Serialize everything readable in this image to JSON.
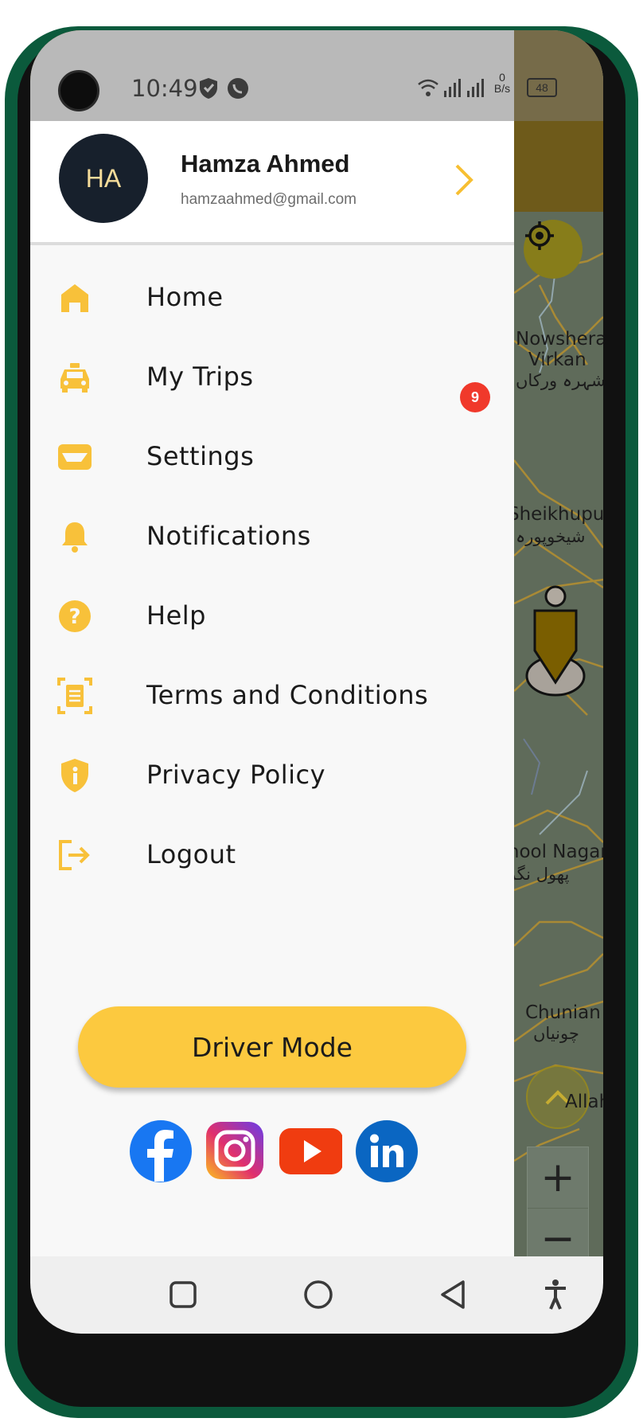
{
  "status_bar": {
    "time": "10:49",
    "speed_value": "0",
    "speed_unit": "B/s",
    "battery": "48"
  },
  "profile": {
    "initials": "HA",
    "name": "Hamza Ahmed",
    "email": "hamzaahmed@gmail.com"
  },
  "menu": {
    "items": [
      {
        "label": "Home",
        "icon": "home-icon"
      },
      {
        "label": "My Trips",
        "icon": "taxi-icon"
      },
      {
        "label": "Settings",
        "icon": "card-icon"
      },
      {
        "label": "Notifications",
        "icon": "bell-icon"
      },
      {
        "label": "Help",
        "icon": "help-icon"
      },
      {
        "label": "Terms and Conditions",
        "icon": "document-scan-icon"
      },
      {
        "label": "Privacy Policy",
        "icon": "shield-info-icon"
      },
      {
        "label": "Logout",
        "icon": "logout-icon"
      }
    ],
    "notifications_badge": "9"
  },
  "driver_mode_label": "Driver Mode",
  "social": [
    "facebook-icon",
    "instagram-icon",
    "youtube-icon",
    "linkedin-icon"
  ],
  "map": {
    "labels": {
      "nowshera_1": "Nowshera",
      "nowshera_2": "Virkan",
      "nowshera_urdu": "نوشہرہ ورکاں",
      "sheikhupura": "Sheikhupura",
      "sheikhupura_urdu": "شیخوپورہ",
      "phool_nagar": "Phool Nagar",
      "phool_nagar_urdu": "پھول نگر",
      "chunian": "Chunian",
      "chunian_urdu": "چونیاں",
      "allah": "Allah"
    },
    "zoom_in": "+",
    "zoom_out": "−"
  },
  "colors": {
    "accent": "#fcc93f",
    "badge": "#f0392b",
    "avatar_bg": "#17202c"
  }
}
